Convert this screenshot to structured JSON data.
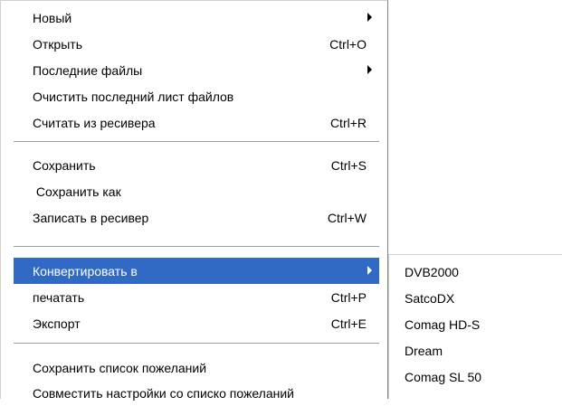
{
  "menu": {
    "groups": [
      [
        {
          "label": "Новый",
          "shortcut": "",
          "submenu": true
        },
        {
          "label": "Открыть",
          "shortcut": "Ctrl+O",
          "submenu": false
        },
        {
          "label": "Последние файлы",
          "shortcut": "",
          "submenu": true
        },
        {
          "label": "Очистить последний лист файлов",
          "shortcut": "",
          "submenu": false
        },
        {
          "label": "Считать из ресивера",
          "shortcut": "Ctrl+R",
          "submenu": false
        }
      ],
      [
        {
          "label": "Сохранить",
          "shortcut": "Ctrl+S",
          "submenu": false
        },
        {
          "label": " Сохранить как",
          "shortcut": "",
          "submenu": false
        },
        {
          "label": "Записать в ресивер",
          "shortcut": "Ctrl+W",
          "submenu": false
        }
      ],
      [
        {
          "label": "Конвертировать в",
          "shortcut": "",
          "submenu": true,
          "highlighted": true
        },
        {
          "label": "печатать",
          "shortcut": "Ctrl+P",
          "submenu": false
        },
        {
          "label": "Экспорт",
          "shortcut": "Ctrl+E",
          "submenu": false
        }
      ],
      [
        {
          "label": "Сохранить список пожеланий",
          "shortcut": "",
          "submenu": false
        },
        {
          "label": "Совместить настройки со списко пожеланий",
          "shortcut": "",
          "submenu": false
        }
      ]
    ]
  },
  "submenu": {
    "items": [
      "DVB2000",
      "SatcoDX",
      "Comag HD-S",
      "Dream",
      "Comag SL 50"
    ]
  },
  "colors": {
    "highlight": "#316ac5",
    "highlight_text": "#ffffff",
    "separator": "#a0a0a0"
  }
}
